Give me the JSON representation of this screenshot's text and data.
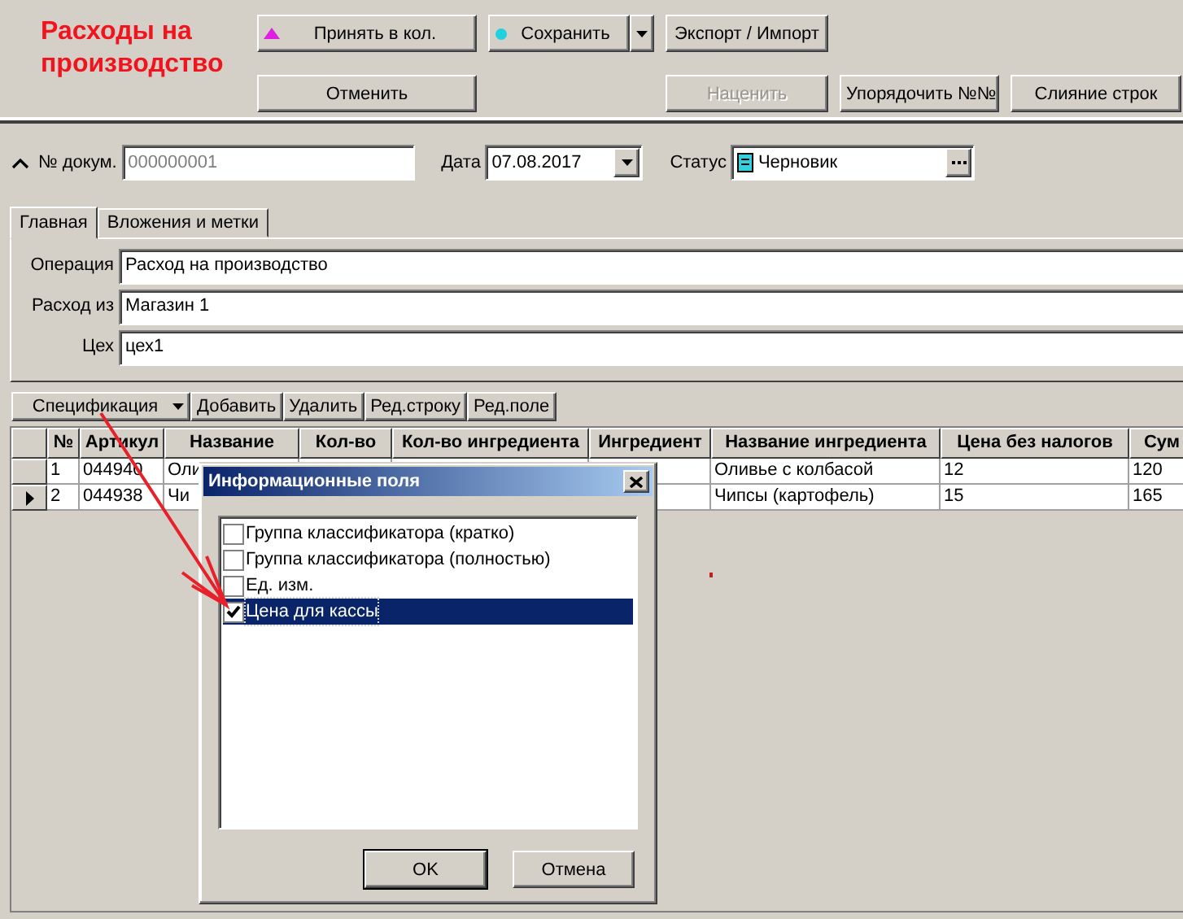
{
  "title": "Расходы на производство",
  "actions_row_1": [
    {
      "label": "Принять в кол.",
      "kind": "accept",
      "disabled": false
    },
    {
      "label": "Сохранить",
      "kind": "save",
      "disabled": false
    },
    {
      "label": "Экспорт / Импорт",
      "kind": "plain",
      "disabled": false
    }
  ],
  "actions_row_2": [
    {
      "label": "Отменить",
      "kind": "plain",
      "disabled": false
    },
    {
      "label": "Наценить",
      "kind": "plain",
      "disabled": true
    },
    {
      "label": "Упорядочить №№",
      "kind": "plain",
      "disabled": false
    },
    {
      "label": "Слияние строк",
      "kind": "plain",
      "disabled": false
    }
  ],
  "document": {
    "number_label": "№ докум.",
    "number": "000000001",
    "date_label": "Дата",
    "date": "07.08.2017",
    "status_label": "Статус",
    "status": "Черновик"
  },
  "tabs": [
    {
      "label": "Главная",
      "selected": true
    },
    {
      "label": "Вложения и метки",
      "selected": false
    }
  ],
  "fields": [
    {
      "label": "Операция",
      "value": "Расход на производство"
    },
    {
      "label": "Расход из",
      "value": "Магазин 1"
    },
    {
      "label": "Цех",
      "value": "цех1"
    }
  ],
  "spec_toolbar": {
    "menu": "Спецификация",
    "buttons": [
      "Добавить",
      "Удалить",
      "Ред.строку",
      "Ред.поле"
    ]
  },
  "table": {
    "columns": [
      "№",
      "Артикул",
      "Название",
      "Кол-во",
      "Кол-во ингредиента",
      "Ингредиент",
      "Название ингредиента",
      "Цена без налогов",
      "Сум"
    ],
    "rows": [
      {
        "current": false,
        "cells": [
          "1",
          "044940",
          "Оли",
          "",
          "",
          "",
          "Оливье с колбасой",
          "12",
          "120"
        ]
      },
      {
        "current": true,
        "cells": [
          "2",
          "044938",
          "Чи",
          "",
          "",
          "",
          "Чипсы (картофель)",
          "15",
          "165"
        ]
      }
    ]
  },
  "dialog": {
    "title": "Информационные поля",
    "items": [
      {
        "label": "Группа классификатора (кратко)",
        "checked": false,
        "selected": false
      },
      {
        "label": "Группа классификатора (полностью)",
        "checked": false,
        "selected": false
      },
      {
        "label": "Ед. изм.",
        "checked": false,
        "selected": false
      },
      {
        "label": "Цена для кассы",
        "checked": true,
        "selected": true
      }
    ],
    "buttons": [
      "OK",
      "Отмена"
    ]
  }
}
